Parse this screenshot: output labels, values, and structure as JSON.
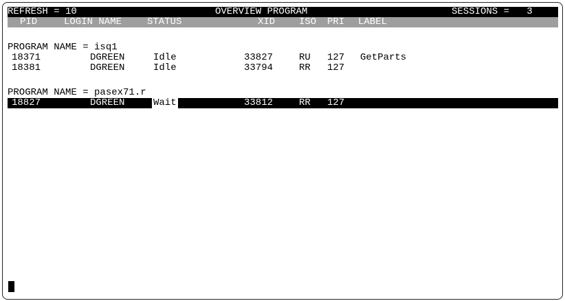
{
  "header": {
    "refresh": "REFRESH = 10",
    "title": "OVERVIEW PROGRAM",
    "sessions": "SESSIONS =   3"
  },
  "columns": {
    "pid": "PID",
    "login": "LOGIN NAME",
    "status": "STATUS",
    "xid": "XID",
    "iso": "ISO",
    "pri": "PRI",
    "label": "LABEL"
  },
  "groups": [
    {
      "title": "PROGRAM NAME = isq1",
      "rows": [
        {
          "pid": "18371",
          "login": "DGREEN",
          "status": "Idle",
          "xid": "33827",
          "iso": "RU",
          "pri": "127",
          "label": "GetParts"
        },
        {
          "pid": "18381",
          "login": "DGREEN",
          "status": "Idle",
          "xid": "33794",
          "iso": "RR",
          "pri": "127",
          "label": ""
        }
      ]
    },
    {
      "title": "PROGRAM NAME = pasex71.r",
      "rows": [
        {
          "pid": "18827",
          "login": "DGREEN",
          "status": "Wait",
          "xid": "33812",
          "iso": "RR",
          "pri": "127",
          "label": ""
        }
      ]
    }
  ],
  "colors": {
    "background": "#ffffff",
    "text": "#000000",
    "header_bar": "#000000",
    "column_bar": "#9e9e9e"
  }
}
